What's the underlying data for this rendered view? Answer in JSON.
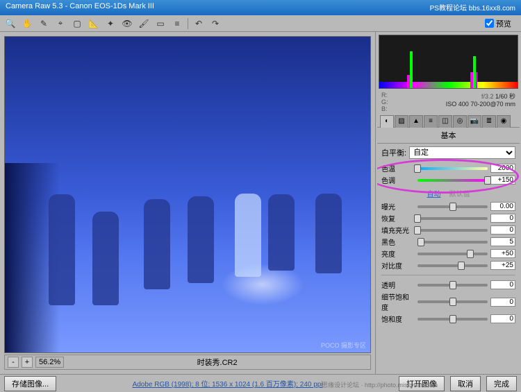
{
  "title": "Camera Raw 5.3 - Canon EOS-1Ds Mark III",
  "watermark_top": "PS教程论坛\nbbs.16xx8.com",
  "toolbar": {
    "preview_checkbox_label": "预览"
  },
  "info": {
    "r_label": "R:",
    "r_val": "",
    "g_label": "G:",
    "g_val": "",
    "b_label": "B:",
    "b_val": "",
    "aperture": "f/3.2",
    "shutter": "1/60 秒",
    "iso": "ISO 400",
    "lens": "70-200@70 mm"
  },
  "panel": {
    "title": "基本",
    "wb_label": "白平衡:",
    "wb_value": "自定",
    "auto": "自动",
    "default": "默认值",
    "sliders": {
      "temp": {
        "label": "色温",
        "value": "2000",
        "pos": 0
      },
      "tint": {
        "label": "色调",
        "value": "+150",
        "pos": 100
      },
      "exposure": {
        "label": "曝光",
        "value": "0.00",
        "pos": 50
      },
      "recovery": {
        "label": "恢复",
        "value": "0",
        "pos": 0
      },
      "fill": {
        "label": "填充亮光",
        "value": "0",
        "pos": 0
      },
      "black": {
        "label": "黑色",
        "value": "5",
        "pos": 5
      },
      "brightness": {
        "label": "亮度",
        "value": "+50",
        "pos": 75
      },
      "contrast": {
        "label": "对比度",
        "value": "+25",
        "pos": 62
      },
      "clarity": {
        "label": "透明",
        "value": "0",
        "pos": 50
      },
      "vibrance": {
        "label": "细节饱和度",
        "value": "0",
        "pos": 50
      },
      "saturation": {
        "label": "饱和度",
        "value": "0",
        "pos": 50
      }
    }
  },
  "zoom": {
    "minus": "-",
    "plus": "+",
    "value": "56.2%"
  },
  "file_label": "时装秀.CR2",
  "poco": "POCO 摄影专区",
  "bottom": {
    "save_btn": "存储图像...",
    "profile": "Adobe RGB (1998); 8 位; 1536 x 1024 (1.6 百万像素); 240 ppi",
    "open": "打开图像",
    "cancel": "取消",
    "done": "完成"
  },
  "watermark_bottom": "思缘设计论坛 · http://photo.missyuan.com"
}
